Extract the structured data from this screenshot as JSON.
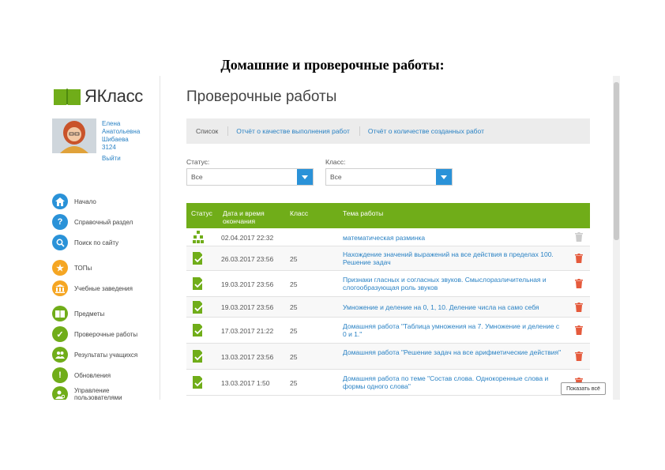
{
  "doc_heading": "Домашние и проверочные работы:",
  "app": {
    "logo_text": "ЯКласс",
    "colors": {
      "brand_green": "#70ad19",
      "link_blue": "#2a82c4",
      "select_blue": "#2a92d8",
      "delete_red": "#e55a3c"
    }
  },
  "profile": {
    "name_lines": [
      "Елена",
      "Анатольевна",
      "Шибаева",
      "3124"
    ],
    "logout": "Выйти"
  },
  "nav": [
    {
      "label": "Начало",
      "icon": "home-icon",
      "color": "#2a92d8"
    },
    {
      "label": "Справочный раздел",
      "icon": "question-icon",
      "color": "#2a92d8"
    },
    {
      "label": "Поиск по сайту",
      "icon": "search-icon",
      "color": "#2a92d8"
    },
    {
      "label": "ТОПы",
      "icon": "star-icon",
      "color": "#f5a623"
    },
    {
      "label": "Учебные заведения",
      "icon": "school-icon",
      "color": "#f5a623"
    },
    {
      "label": "Предметы",
      "icon": "book-icon",
      "color": "#70ad19"
    },
    {
      "label": "Проверочные работы",
      "icon": "check-icon",
      "color": "#70ad19"
    },
    {
      "label": "Результаты учащихся",
      "icon": "users-icon",
      "color": "#70ad19"
    },
    {
      "label": "Обновления",
      "icon": "exclamation-icon",
      "color": "#70ad19"
    },
    {
      "label": "Управление пользователями",
      "icon": "user-settings-icon",
      "color": "#70ad19"
    }
  ],
  "page_title": "Проверочные работы",
  "tabs": [
    {
      "label": "Список"
    },
    {
      "label": "Отчёт о качестве выполнения работ"
    },
    {
      "label": "Отчёт о количестве созданных работ"
    }
  ],
  "filters": {
    "status_label": "Статус:",
    "status_value": "Все",
    "class_label": "Класс:",
    "class_value": "Все"
  },
  "table": {
    "headers": {
      "status": "Статус",
      "date": "Дата и время окончания",
      "class": "Класс",
      "topic": "Тема работы"
    },
    "rows": [
      {
        "status_icon": "tree-icon",
        "date": "02.04.2017 22:32",
        "class": "",
        "topic": "математическая разминка"
      },
      {
        "status_icon": "doc-check-icon",
        "date": "26.03.2017 23:56",
        "class": "25",
        "topic": "Нахождение значений выражений на все действия в пределах 100. Решение задач"
      },
      {
        "status_icon": "doc-check-icon",
        "date": "19.03.2017 23:56",
        "class": "25",
        "topic": "Признаки гласных и согласных звуков. Смыслоразличительная и слогообразующая роль звуков"
      },
      {
        "status_icon": "doc-check-icon",
        "date": "19.03.2017 23:56",
        "class": "25",
        "topic": "Умножение и деление на 0, 1, 10. Деление числа на само себя"
      },
      {
        "status_icon": "doc-check-icon",
        "date": "17.03.2017 21:22",
        "class": "25",
        "topic": "Домашняя работа \"Таблица умножения на 7. Умножение и деление с 0 и 1.\""
      },
      {
        "status_icon": "doc-check-icon",
        "date": "13.03.2017 23:56",
        "class": "25",
        "topic": "Домашняя работа \"Решение задач на все арифметические действия\""
      },
      {
        "status_icon": "doc-check-icon",
        "date": "13.03.2017 1:50",
        "class": "25",
        "topic": "Домашняя работа по теме \"Состав слова. Однокоренные слова и формы одного слова\""
      }
    ]
  },
  "floating_button": "Показать всё"
}
